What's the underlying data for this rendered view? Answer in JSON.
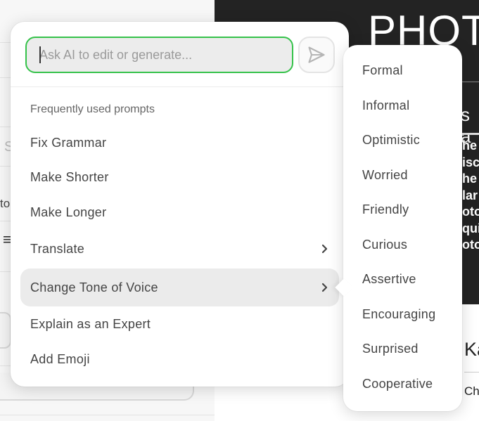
{
  "background": {
    "left_fragments": {
      "strike_icon": "S",
      "to_text": "to",
      "list_icon": "≡"
    },
    "right": {
      "photo_title": "PHOT",
      "dark_subheading": "s a",
      "dark_lines": [
        "he a",
        "isco",
        "he a",
        "lar",
        "otog",
        "quip",
        "otog"
      ],
      "author_fragment": "Ka",
      "author_sub_fragment": "Ch"
    }
  },
  "ai_popup": {
    "prompt_input": {
      "placeholder": "Ask AI to edit or generate...",
      "value": ""
    },
    "send_button_icon": "send-icon",
    "section_heading": "Frequently used prompts",
    "items": [
      {
        "label": "Fix Grammar",
        "has_submenu": false,
        "active": false
      },
      {
        "label": "Make Shorter",
        "has_submenu": false,
        "active": false
      },
      {
        "label": "Make Longer",
        "has_submenu": false,
        "active": false
      },
      {
        "label": "Translate",
        "has_submenu": true,
        "active": false
      },
      {
        "label": "Change Tone of Voice",
        "has_submenu": true,
        "active": true
      },
      {
        "label": "Explain as an Expert",
        "has_submenu": false,
        "active": false
      },
      {
        "label": "Add Emoji",
        "has_submenu": false,
        "active": false
      }
    ],
    "accent_color": "#35c24a"
  },
  "tone_submenu": {
    "items": [
      "Formal",
      "Informal",
      "Optimistic",
      "Worried",
      "Friendly",
      "Curious",
      "Assertive",
      "Encouraging",
      "Surprised",
      "Cooperative"
    ]
  }
}
